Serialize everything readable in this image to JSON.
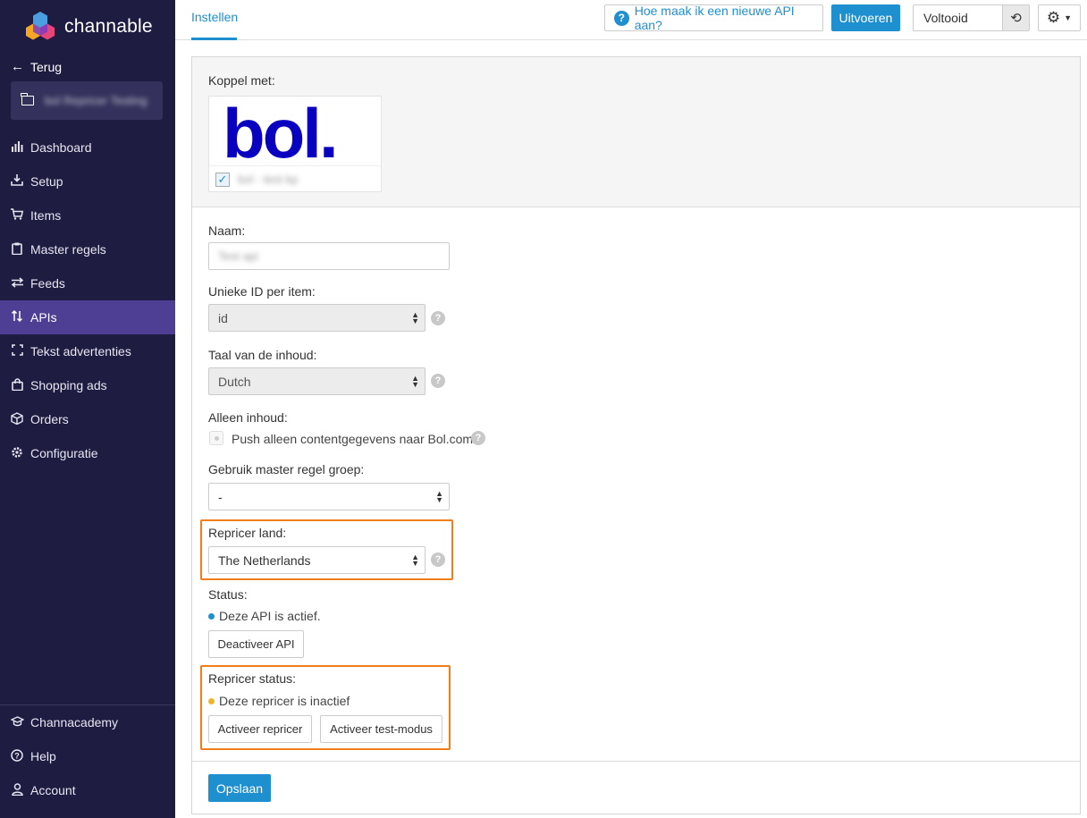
{
  "brand": {
    "name": "channable"
  },
  "sidebar": {
    "back_label": "Terug",
    "project_name": "bol Repricer Testing",
    "items": [
      {
        "label": "Dashboard",
        "icon": "bar-chart-icon"
      },
      {
        "label": "Setup",
        "icon": "download-tray-icon"
      },
      {
        "label": "Items",
        "icon": "cart-icon"
      },
      {
        "label": "Master regels",
        "icon": "clipboard-icon"
      },
      {
        "label": "Feeds",
        "icon": "swap-arrows-icon"
      },
      {
        "label": "APIs",
        "icon": "updown-arrows-icon",
        "active": true
      },
      {
        "label": "Tekst advertenties",
        "icon": "frame-icon"
      },
      {
        "label": "Shopping ads",
        "icon": "shopping-bag-icon"
      },
      {
        "label": "Orders",
        "icon": "box-icon"
      },
      {
        "label": "Configuratie",
        "icon": "gear-icon"
      }
    ],
    "bottom_items": [
      {
        "label": "Channacademy",
        "icon": "graduation-cap-icon"
      },
      {
        "label": "Help",
        "icon": "question-circle-icon"
      },
      {
        "label": "Account",
        "icon": "user-icon"
      }
    ]
  },
  "topbar": {
    "tab_label": "Instellen",
    "help_label": "Hoe maak ik een nieuwe API aan?",
    "run_label": "Uitvoeren",
    "status_value": "Voltooid"
  },
  "form": {
    "koppel_label": "Koppel met:",
    "bol_logo_text": "bol.",
    "bol_account": "bol - test kp",
    "naam_label": "Naam:",
    "naam_value": "Test api",
    "unique_id_label": "Unieke ID per item:",
    "unique_id_value": "id",
    "taal_label": "Taal van de inhoud:",
    "taal_value": "Dutch",
    "alleen_label": "Alleen inhoud:",
    "alleen_text": "Push alleen contentgegevens naar Bol.com.",
    "master_label": "Gebruik master regel groep:",
    "master_value": "-",
    "repricer_land_label": "Repricer land:",
    "repricer_land_value": "The Netherlands",
    "status_label": "Status:",
    "status_text": "Deze API is actief.",
    "deactivate_label": "Deactiveer API",
    "repricer_status_label": "Repricer status:",
    "repricer_status_text": "Deze repricer is inactief",
    "activate_repricer_label": "Activeer repricer",
    "activate_test_label": "Activeer test-modus",
    "save_label": "Opslaan"
  },
  "colors": {
    "sidebar_bg": "#1f1c42",
    "sidebar_active": "#4e3f95",
    "accent_blue": "#1e90d0",
    "highlight_orange": "#f07e1b",
    "status_active_dot": "#1e90d0",
    "status_inactive_dot": "#f0b429",
    "bol_blue": "#0a00c0"
  }
}
